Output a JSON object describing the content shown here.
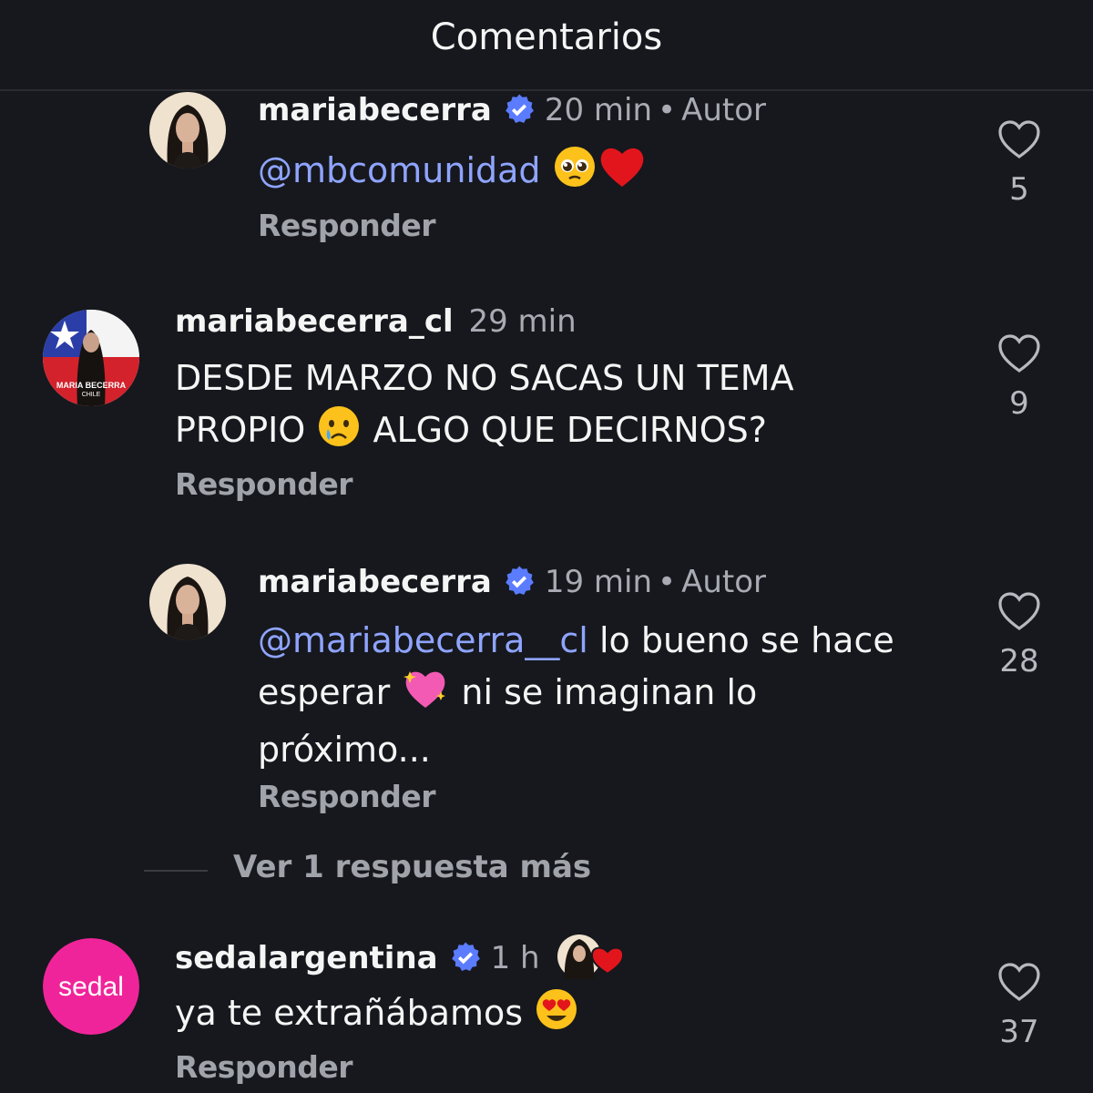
{
  "header": {
    "title": "Comentarios"
  },
  "comments": [
    {
      "username": "mariabecerra",
      "time": "20 min",
      "separator": "•",
      "role": "Autor",
      "mention": "@mbcomunidad",
      "text_after": "",
      "reply_label": "Responder",
      "likes": "5"
    },
    {
      "username": "mariabecerra_cl",
      "time": "29 min",
      "line1": "DESDE MARZO NO SACAS UN TEMA",
      "line2a": "PROPIO",
      "line2b": "ALGO QUE DECIRNOS?",
      "avatar_text1": "MARIA BECERRA",
      "avatar_text2": "CHILE",
      "reply_label": "Responder",
      "likes": "9"
    },
    {
      "username": "mariabecerra",
      "time": "19 min",
      "separator": "•",
      "role": "Autor",
      "mention": "@mariabecerra__cl",
      "line1_rest": " lo bueno se hace",
      "line2a": "esperar",
      "line2b": "ni se imaginan lo",
      "line3": "próximo...",
      "reply_label": "Responder",
      "likes": "28"
    },
    {
      "username": "sedalargentina",
      "time": "1 h",
      "text": "ya te extrañábamos",
      "avatar_text": "sedal",
      "reply_label": "Responder",
      "likes": "37"
    }
  ],
  "more_replies": "Ver 1 respuesta más",
  "colors": {
    "background": "#16181d",
    "mention": "#8fa4ff",
    "verified": "#5b7cff",
    "sedal_pink": "#f0249a"
  },
  "icons": [
    "heart-outline-icon",
    "verified-badge-icon",
    "threads-at-icon"
  ]
}
